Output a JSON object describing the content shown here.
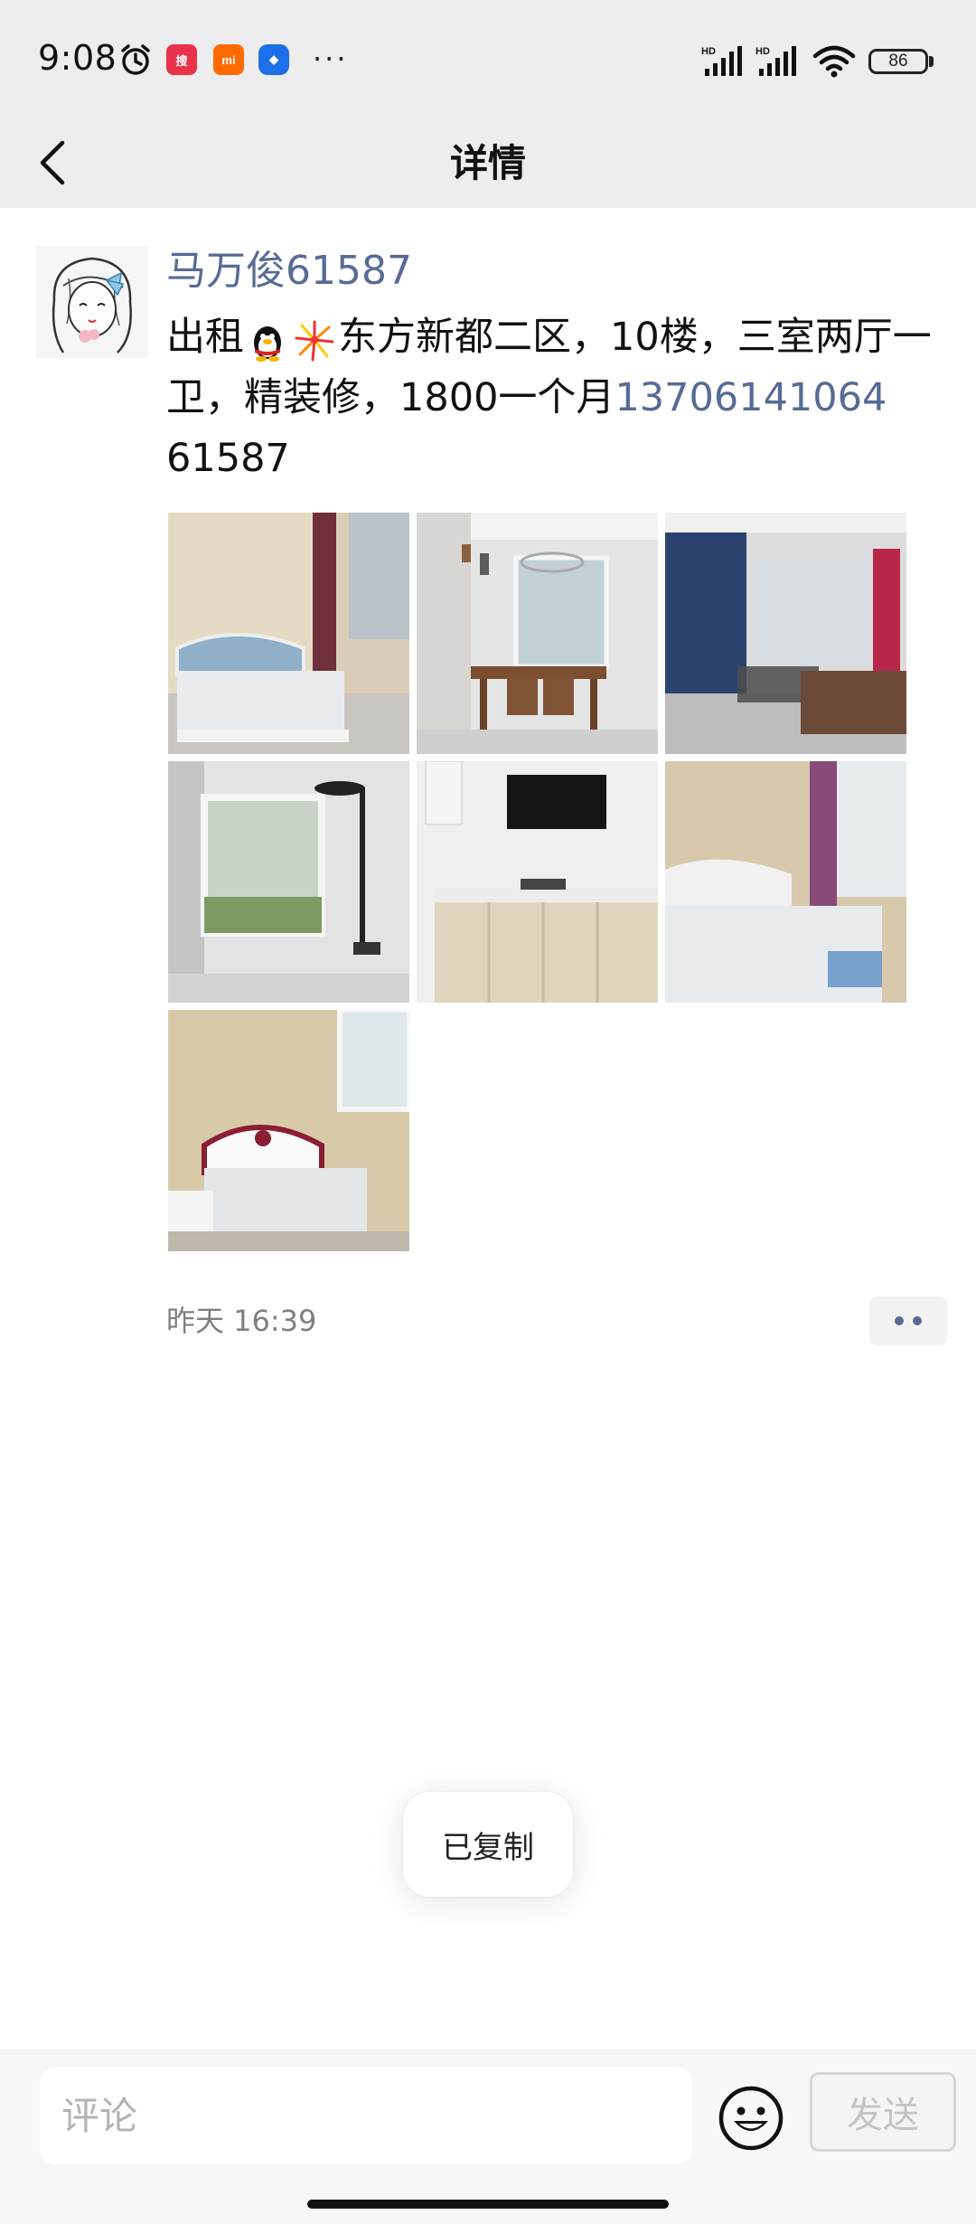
{
  "status_bar": {
    "time": "9:08",
    "battery": "86",
    "more": "···",
    "icons": [
      "alarm-icon",
      "souhu-app-icon",
      "mi-app-icon",
      "blue-app-icon",
      "hd-signal-icon",
      "hd-signal-icon",
      "wifi-icon",
      "battery-icon"
    ]
  },
  "nav": {
    "title": "详情",
    "back_icon": "chevron-left-icon"
  },
  "post": {
    "author": "马万俊61587",
    "text_start": "出租",
    "emojis": [
      "qq-penguin-emoji",
      "fireworks-emoji"
    ],
    "text_main": "东方新都二区，10楼，三室两厅一卫，精装修，1800一个月",
    "phone": "13706141064",
    "text_end": "61587",
    "photos": [
      "bedroom-bed-photo",
      "dining-room-photo",
      "living-room-photo",
      "bathroom-photo",
      "kitchen-photo",
      "bedroom-mattress-photo",
      "bedroom-red-bed-photo"
    ],
    "timestamp": "昨天 16:39",
    "more_icon": "more-dots-icon"
  },
  "toast": {
    "text": "已复制"
  },
  "comment_bar": {
    "placeholder": "评论",
    "emoji_icon": "smiley-icon",
    "send_label": "发送"
  },
  "colors": {
    "link": "#576b95",
    "header_bg": "#ededed",
    "bottom_bg": "#f7f7f7"
  }
}
